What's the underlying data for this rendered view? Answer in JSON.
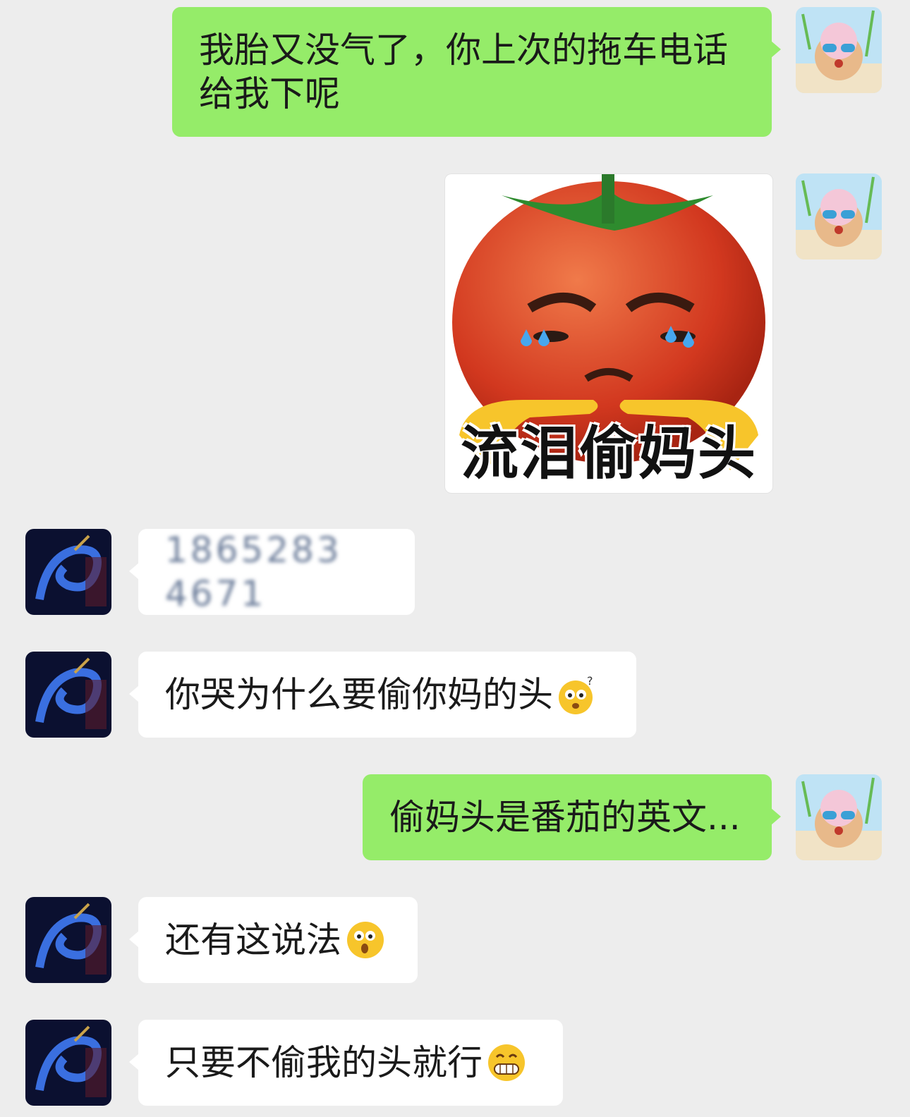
{
  "messages": [
    {
      "from": "me",
      "type": "text",
      "text": "我胎又没气了，你上次的拖车电话给我下呢"
    },
    {
      "from": "me",
      "type": "sticker",
      "caption": "流泪偷妈头"
    },
    {
      "from": "them",
      "type": "text",
      "text": "1865283 4671",
      "note_blurred": true
    },
    {
      "from": "them",
      "type": "text",
      "text": "你哭为什么要偷你妈的头",
      "emoji": "confused-face-emoji"
    },
    {
      "from": "me",
      "type": "text",
      "text": "偷妈头是番茄的英文..."
    },
    {
      "from": "them",
      "type": "text",
      "text": "还有这说法",
      "emoji": "surprised-face-emoji"
    },
    {
      "from": "them",
      "type": "text",
      "text": "只要不偷我的头就行",
      "emoji": "grinning-face-emoji"
    }
  ],
  "avatars": {
    "me": "bear-avatar-icon",
    "them": "dragon-avatar-icon"
  },
  "colors": {
    "me_bubble": "#95ec69",
    "them_bubble": "#ffffff",
    "background": "#ededed"
  }
}
